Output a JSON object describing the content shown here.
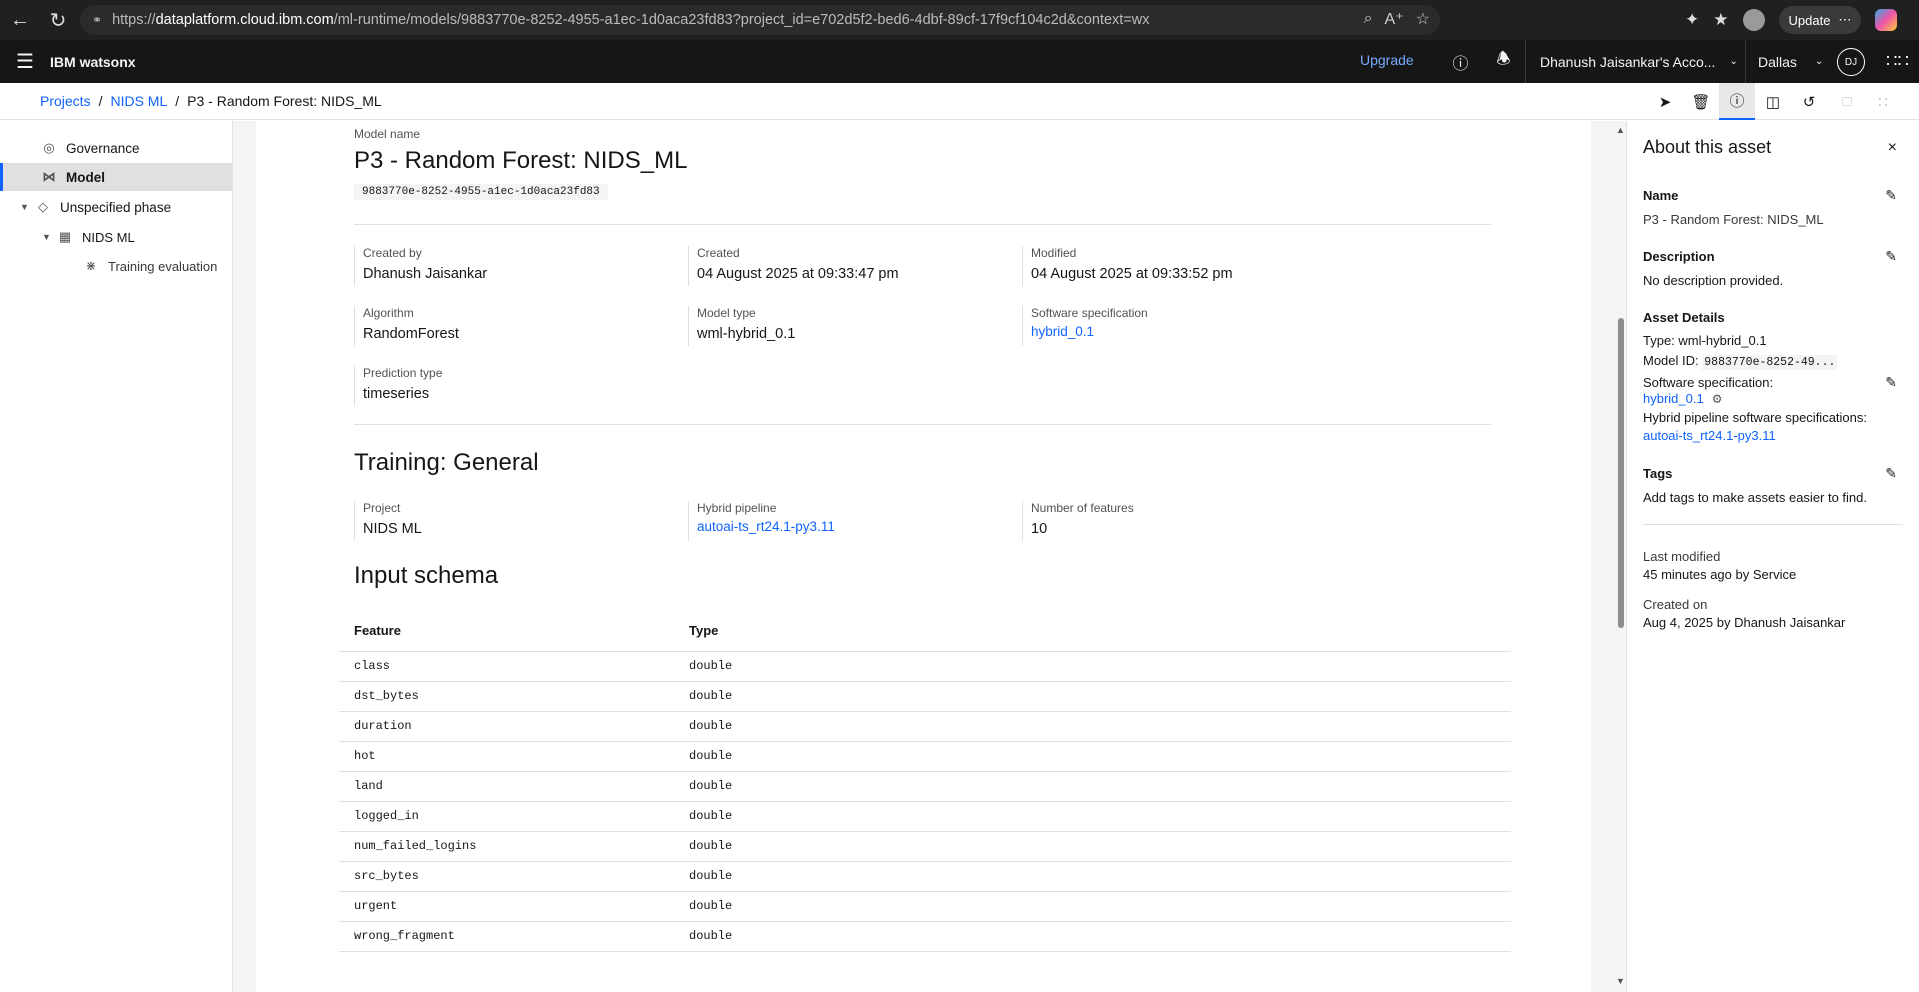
{
  "browser": {
    "url_prefix": "https://",
    "url_host": "dataplatform.cloud.ibm.com",
    "url_path": "/ml-runtime/models/9883770e-8252-4955-a1ec-1d0aca23fd83?project_id=e702d5f2-bed6-4dbf-89cf-17f9cf104c2d&context=wx",
    "update_label": "Update"
  },
  "appbar": {
    "brand_bold": "IBM",
    "brand_name": "watsonx",
    "upgrade_label": "Upgrade",
    "account": "Dhanush Jaisankar's Acco...",
    "region": "Dallas",
    "avatar_initials": "DJ"
  },
  "breadcrumb": {
    "items": [
      "Projects",
      "NIDS ML"
    ],
    "current": "P3 - Random Forest: NIDS_ML"
  },
  "sidebar": {
    "governance": "Governance",
    "model": "Model",
    "phase": "Unspecified phase",
    "project": "NIDS ML",
    "training_eval": "Training evaluation"
  },
  "model": {
    "name_label": "Model name",
    "name": "P3 - Random Forest: NIDS_ML",
    "id": "9883770e-8252-4955-a1ec-1d0aca23fd83",
    "created_by_label": "Created by",
    "created_by": "Dhanush Jaisankar",
    "created_label": "Created",
    "created": "04 August 2025 at 09:33:47 pm",
    "modified_label": "Modified",
    "modified": "04 August 2025 at 09:33:52 pm",
    "algorithm_label": "Algorithm",
    "algorithm": "RandomForest",
    "model_type_label": "Model type",
    "model_type": "wml-hybrid_0.1",
    "software_spec_label": "Software specification",
    "software_spec": "hybrid_0.1",
    "prediction_type_label": "Prediction type",
    "prediction_type": "timeseries"
  },
  "training": {
    "heading": "Training: General",
    "project_label": "Project",
    "project": "NIDS ML",
    "pipeline_label": "Hybrid pipeline",
    "pipeline": "autoai-ts_rt24.1-py3.11",
    "features_label": "Number of features",
    "features": "10"
  },
  "schema": {
    "heading": "Input schema",
    "col_feature": "Feature",
    "col_type": "Type",
    "rows": [
      {
        "feature": "class",
        "type": "double"
      },
      {
        "feature": "dst_bytes",
        "type": "double"
      },
      {
        "feature": "duration",
        "type": "double"
      },
      {
        "feature": "hot",
        "type": "double"
      },
      {
        "feature": "land",
        "type": "double"
      },
      {
        "feature": "logged_in",
        "type": "double"
      },
      {
        "feature": "num_failed_logins",
        "type": "double"
      },
      {
        "feature": "src_bytes",
        "type": "double"
      },
      {
        "feature": "urgent",
        "type": "double"
      },
      {
        "feature": "wrong_fragment",
        "type": "double"
      }
    ]
  },
  "panel": {
    "title": "About this asset",
    "name_h": "Name",
    "name": "P3 - Random Forest: NIDS_ML",
    "desc_h": "Description",
    "desc": "No description provided.",
    "details_h": "Asset Details",
    "type_label": "Type:",
    "type": "wml-hybrid_0.1",
    "model_id_label": "Model ID:",
    "model_id": "9883770e-8252-49...",
    "spec_label": "Software specification:",
    "spec": "hybrid_0.1",
    "hybrid_label": "Hybrid pipeline software specifications:",
    "hybrid": "autoai-ts_rt24.1-py3.11",
    "tags_h": "Tags",
    "tags": "Add tags to make assets easier to find.",
    "last_mod_h": "Last modified",
    "last_mod": "45 minutes ago by Service",
    "created_h": "Created on",
    "created": "Aug 4, 2025 by Dhanush Jaisankar"
  }
}
